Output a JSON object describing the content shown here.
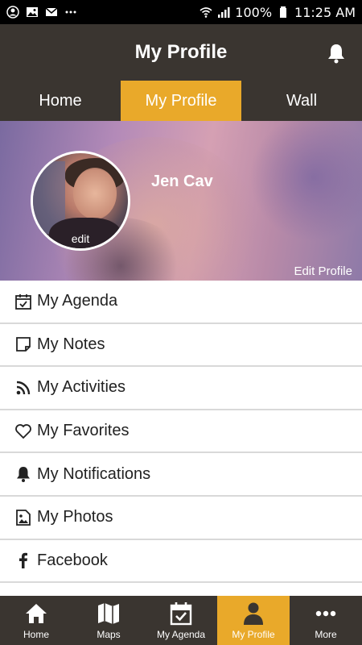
{
  "status_bar": {
    "battery": "100%",
    "time": "11:25 AM",
    "icons": [
      "account-circle-icon",
      "image-icon",
      "mail-icon",
      "more-dots-icon",
      "wifi-icon",
      "signal-icon",
      "battery-icon"
    ]
  },
  "app_bar": {
    "title": "My Profile",
    "bell_icon": "bell-icon"
  },
  "tabs": [
    {
      "label": "Home",
      "active": false
    },
    {
      "label": "My Profile",
      "active": true
    },
    {
      "label": "Wall",
      "active": false
    }
  ],
  "profile": {
    "name": "Jen Cav",
    "avatar_edit": "edit",
    "edit_profile": "Edit Profile"
  },
  "menu": [
    {
      "label": "My Agenda",
      "icon": "calendar-check-icon"
    },
    {
      "label": "My Notes",
      "icon": "note-icon"
    },
    {
      "label": "My Activities",
      "icon": "rss-icon"
    },
    {
      "label": "My Favorites",
      "icon": "heart-icon"
    },
    {
      "label": "My Notifications",
      "icon": "bell-icon"
    },
    {
      "label": "My Photos",
      "icon": "photo-icon"
    },
    {
      "label": "Facebook",
      "icon": "facebook-icon"
    }
  ],
  "bottom_nav": [
    {
      "label": "Home",
      "icon": "home-icon",
      "active": false
    },
    {
      "label": "Maps",
      "icon": "map-icon",
      "active": false
    },
    {
      "label": "My Agenda",
      "icon": "calendar-check-icon",
      "active": false
    },
    {
      "label": "My Profile",
      "icon": "user-icon",
      "active": true
    },
    {
      "label": "More",
      "icon": "more-dots-icon",
      "active": false
    }
  ],
  "colors": {
    "app_bar": "#3a3530",
    "accent": "#e9a92a",
    "status_bar": "#000000"
  }
}
